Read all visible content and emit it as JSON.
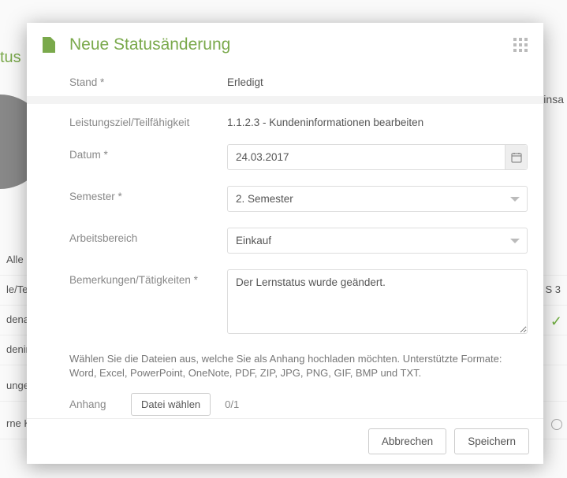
{
  "background": {
    "header_partial": "tus",
    "right_header": "Einsa",
    "tab_alle": "Alle",
    "row1": "le/Te",
    "row1_right": "S 3",
    "row2": "dena",
    "row3": "denin",
    "row4": "ungen",
    "row5": "rne K"
  },
  "modal": {
    "title": "Neue Statusänderung",
    "fields": {
      "stand_label": "Stand *",
      "stand_value": "Erledigt",
      "lz_label": "Leistungsziel/Teilfähigkeit",
      "lz_value": "1.1.2.3 - Kundeninformationen bearbeiten",
      "datum_label": "Datum *",
      "datum_value": "24.03.2017",
      "semester_label": "Semester *",
      "semester_value": "2. Semester",
      "arbeits_label": "Arbeitsbereich",
      "arbeits_value": "Einkauf",
      "bem_label": "Bemerkungen/Tätigkeiten *",
      "bem_value": "Der Lernstatus wurde geändert."
    },
    "upload_hint": "Wählen Sie die Dateien aus, welche Sie als Anhang hochladen möchten. Unterstützte Formate: Word, Excel, PowerPoint, OneNote, PDF, ZIP, JPG, PNG, GIF, BMP und TXT.",
    "anhang_label": "Anhang",
    "choose_file": "Datei wählen",
    "file_count": "0/1",
    "placeholder_dash": "-",
    "cancel": "Abbrechen",
    "save": "Speichern"
  }
}
